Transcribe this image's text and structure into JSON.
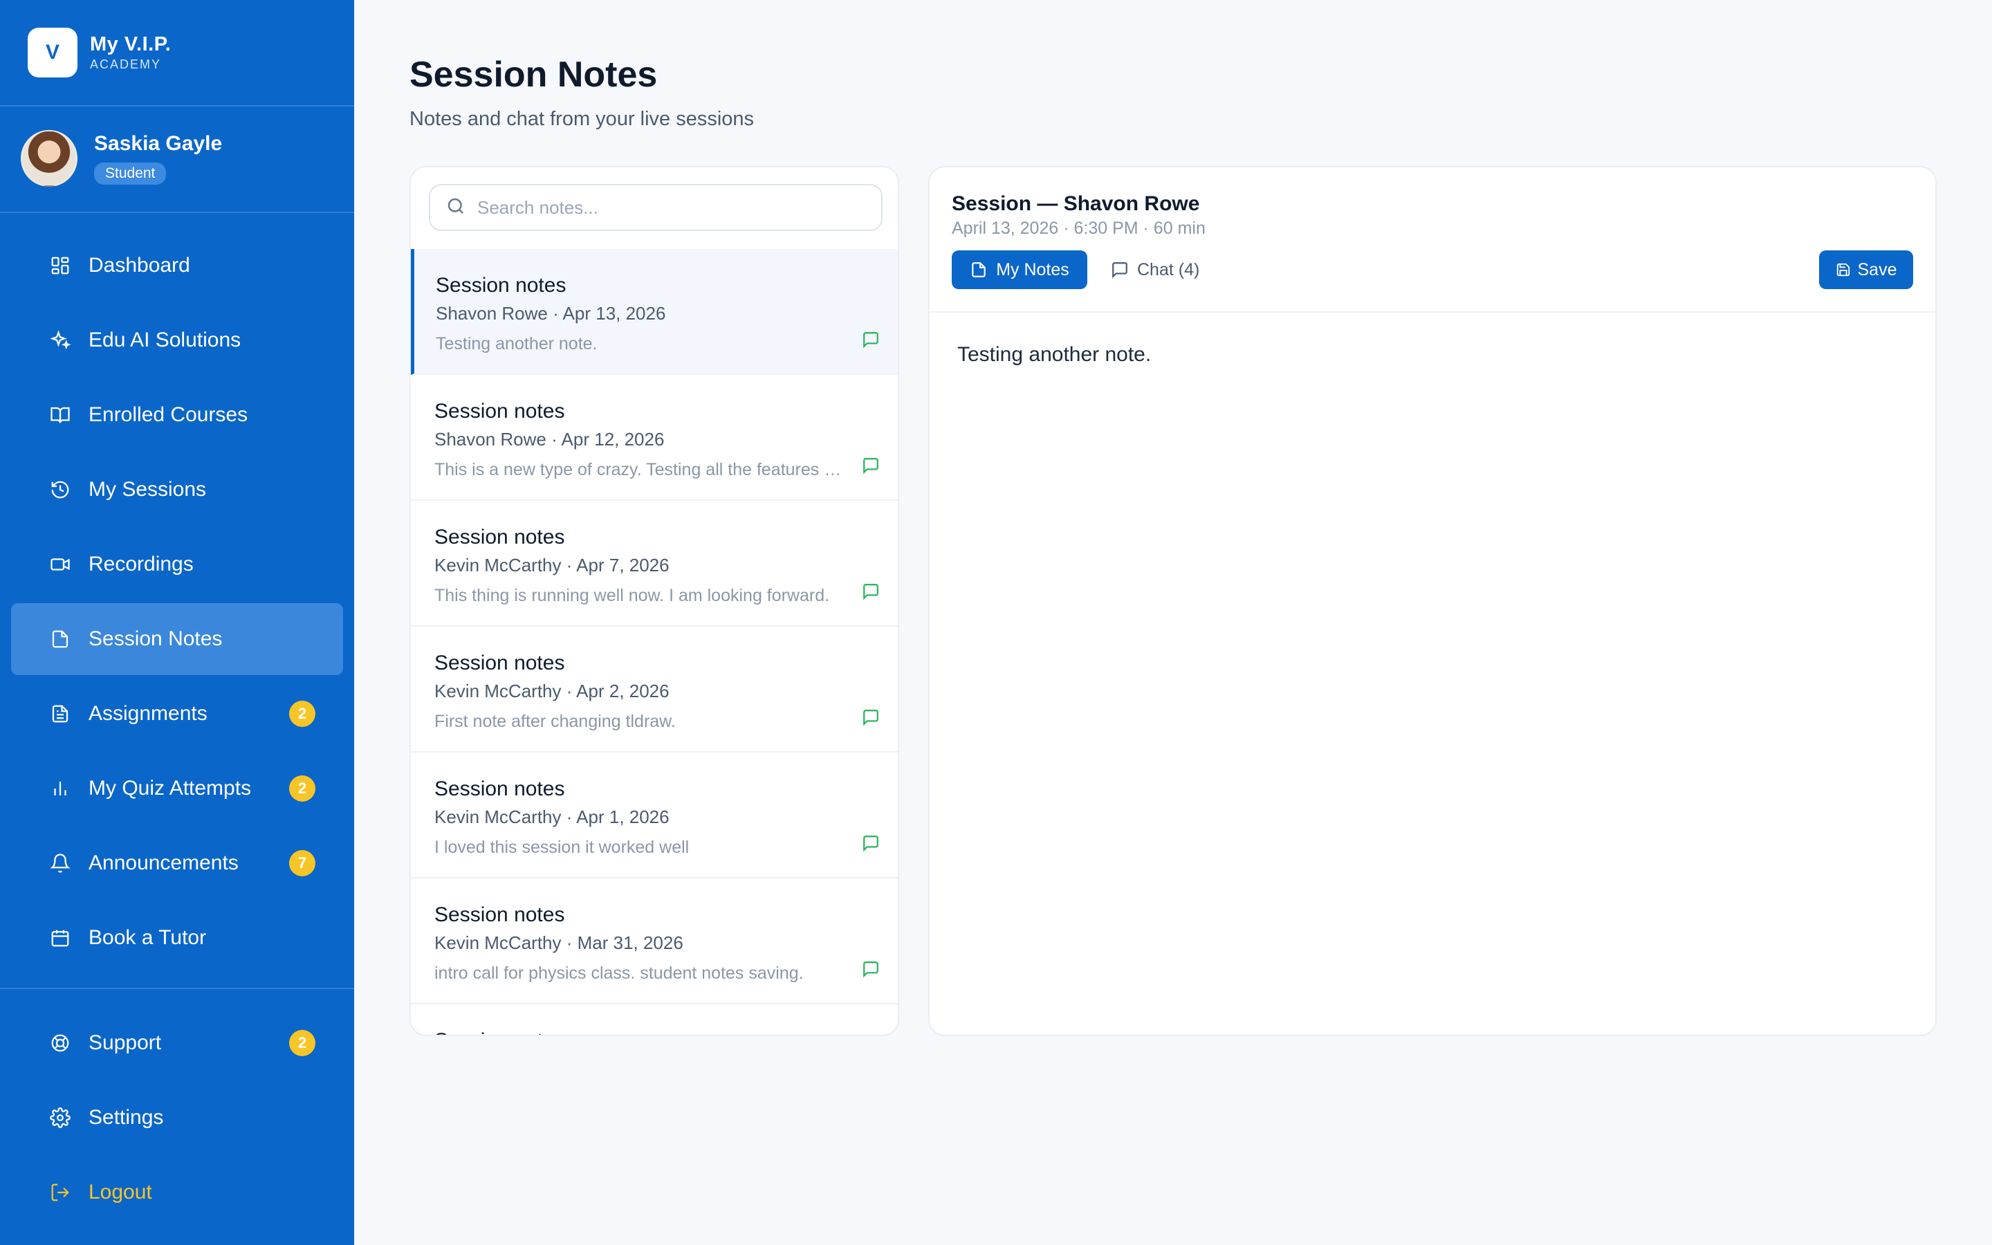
{
  "brand": {
    "logo_letter": "V",
    "name": "My V.I.P.",
    "sub": "ACADEMY"
  },
  "profile": {
    "name": "Saskia Gayle",
    "role": "Student"
  },
  "nav": {
    "items": [
      {
        "label": "Dashboard",
        "icon": "grid-icon"
      },
      {
        "label": "Edu AI Solutions",
        "icon": "sparkle-icon"
      },
      {
        "label": "Enrolled Courses",
        "icon": "book-icon"
      },
      {
        "label": "My Sessions",
        "icon": "history-icon"
      },
      {
        "label": "Recordings",
        "icon": "video-icon"
      },
      {
        "label": "Session Notes",
        "icon": "file-icon",
        "active": true
      },
      {
        "label": "Assignments",
        "icon": "document-icon",
        "badge": "2"
      },
      {
        "label": "My Quiz Attempts",
        "icon": "bar-chart-icon",
        "badge": "2"
      },
      {
        "label": "Announcements",
        "icon": "bell-icon",
        "badge": "7"
      },
      {
        "label": "Book a Tutor",
        "icon": "calendar-icon"
      }
    ],
    "bottom": [
      {
        "label": "Support",
        "icon": "lifebuoy-icon",
        "badge": "2"
      },
      {
        "label": "Settings",
        "icon": "gear-icon"
      },
      {
        "label": "Logout",
        "icon": "logout-icon"
      }
    ]
  },
  "page": {
    "title": "Session Notes",
    "subtitle": "Notes and chat from your live sessions"
  },
  "search": {
    "placeholder": "Search notes...",
    "value": ""
  },
  "notes": [
    {
      "title": "Session notes",
      "meta": "Shavon Rowe · Apr 13, 2026",
      "preview": "Testing another note."
    },
    {
      "title": "Session notes",
      "meta": "Shavon Rowe · Apr 12, 2026",
      "preview": "This is a new type of crazy. Testing all the features at once to see what happens."
    },
    {
      "title": "Session notes",
      "meta": "Kevin McCarthy · Apr 7, 2026",
      "preview": "This thing is running well now. I am looking forward."
    },
    {
      "title": "Session notes",
      "meta": "Kevin McCarthy · Apr 2, 2026",
      "preview": "First note after changing tldraw."
    },
    {
      "title": "Session notes",
      "meta": "Kevin McCarthy · Apr 1, 2026",
      "preview": "I loved this session it worked well"
    },
    {
      "title": "Session notes",
      "meta": "Kevin McCarthy · Mar 31, 2026",
      "preview": "intro call for physics class. student notes saving."
    },
    {
      "title": "Session notes",
      "meta": "",
      "preview": ""
    }
  ],
  "detail": {
    "title": "Session — Shavon Rowe",
    "meta": "April 13, 2026 · 6:30 PM · 60 min",
    "tab_notes": "My Notes",
    "tab_chat": "Chat (4)",
    "save_label": "Save",
    "body": "Testing another note."
  },
  "colors": {
    "sidebar": "#0b66c9",
    "active_item": "#3a87dc",
    "badge": "#f7c526",
    "chat_icon": "#22b357"
  }
}
